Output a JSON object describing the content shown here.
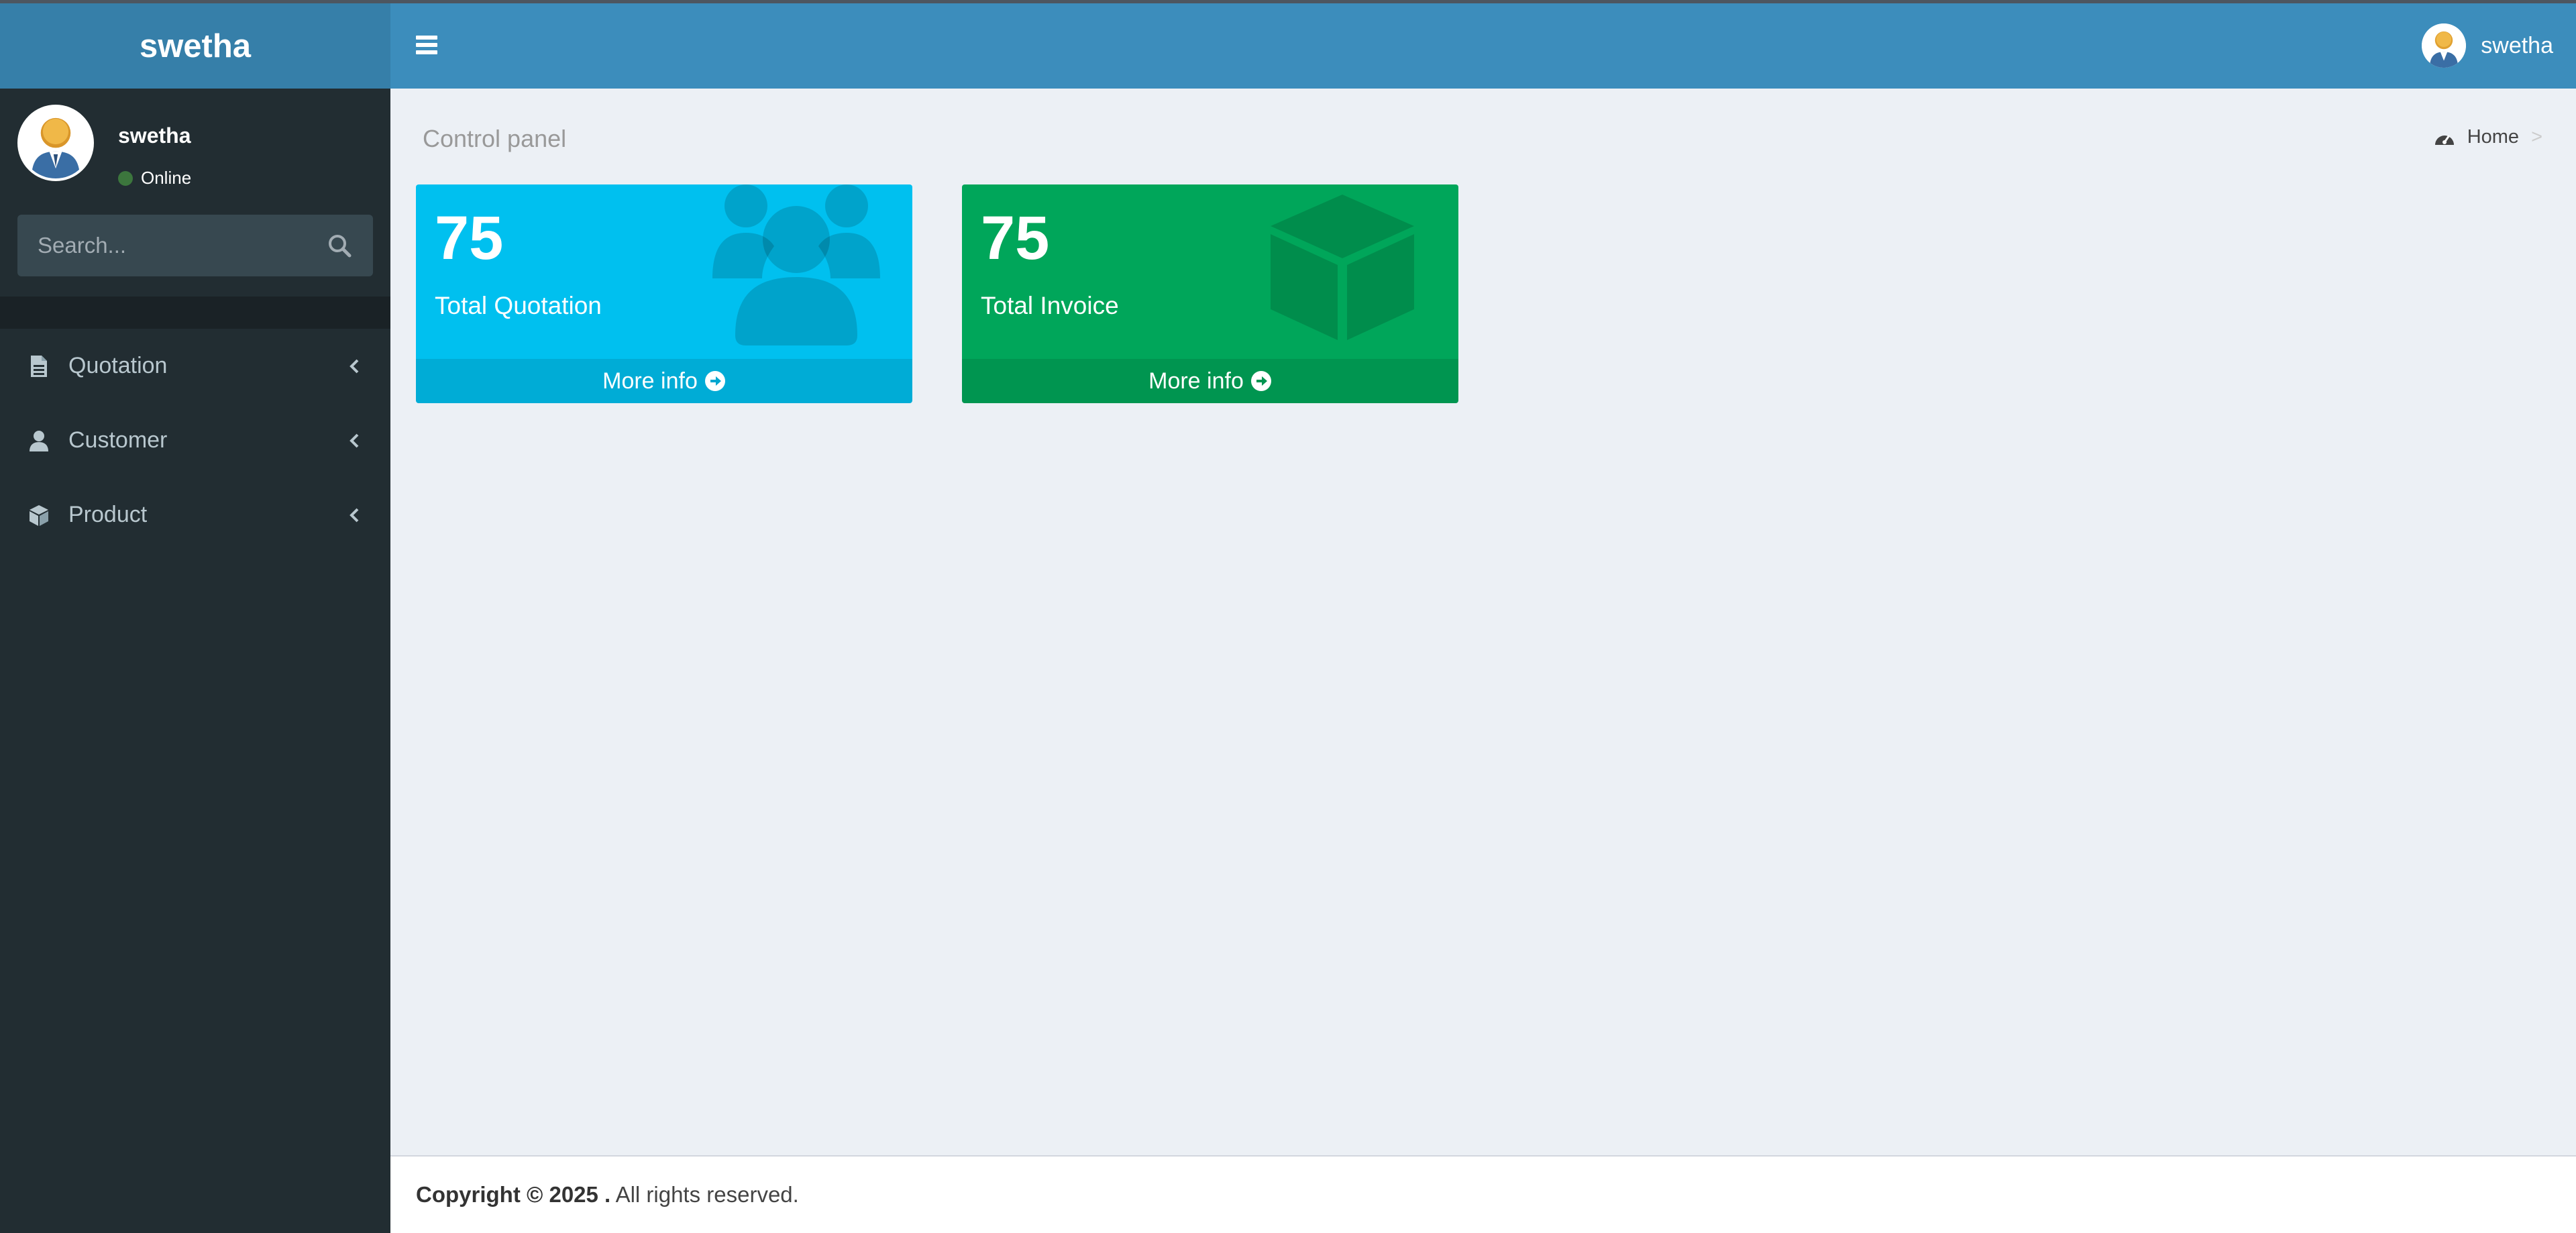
{
  "brand": {
    "logo_text": "swetha"
  },
  "navbar": {
    "user_name": "swetha"
  },
  "sidebar": {
    "user": {
      "name": "swetha",
      "status": "Online"
    },
    "search": {
      "placeholder": "Search..."
    },
    "items": [
      {
        "label": "Quotation",
        "icon": "file-icon"
      },
      {
        "label": "Customer",
        "icon": "user-icon"
      },
      {
        "label": "Product",
        "icon": "cube-icon"
      }
    ]
  },
  "content": {
    "title": "Control panel",
    "breadcrumb": {
      "home": "Home",
      "separator": ">"
    },
    "boxes": [
      {
        "number": "75",
        "label": "Total Quotation",
        "more": "More info",
        "color": "#00c0ef",
        "icon": "users-icon"
      },
      {
        "number": "75",
        "label": "Total Invoice",
        "more": "More info",
        "color": "#00a65a",
        "icon": "cube-icon"
      }
    ]
  },
  "footer": {
    "copyright": "Copyright © 2025 .",
    "rights": " All rights reserved."
  },
  "colors": {
    "navbar": "#3c8dbc",
    "logo": "#367fa9",
    "sidebar": "#222d32",
    "content_bg": "#ecf0f5",
    "aqua": "#00c0ef",
    "green": "#00a65a"
  }
}
